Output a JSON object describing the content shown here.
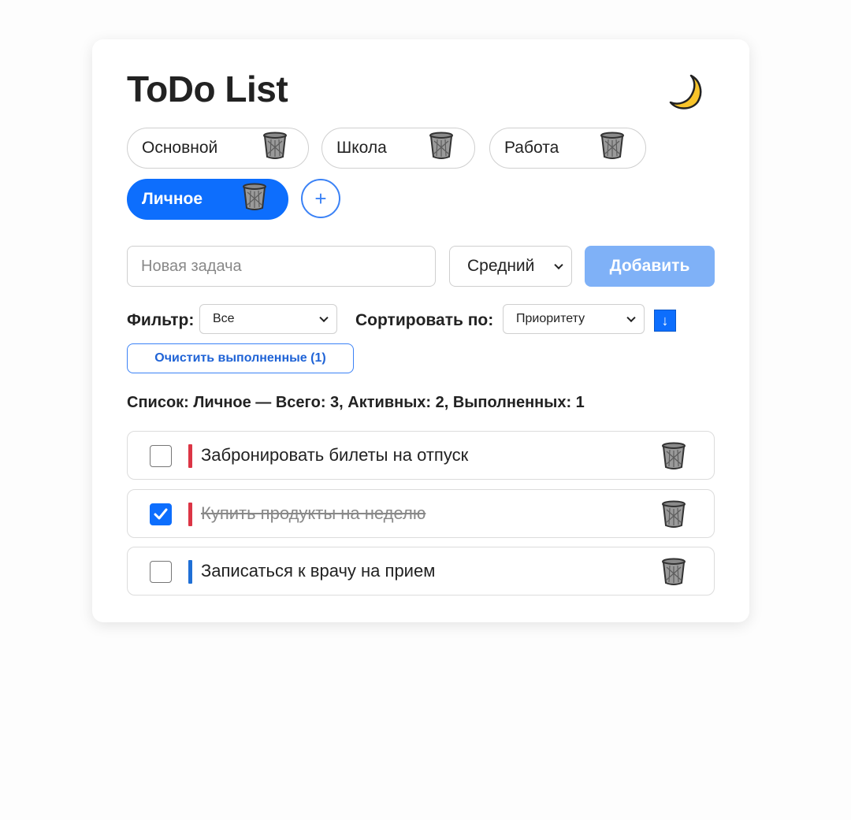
{
  "app": {
    "title": "ToDo List",
    "theme_icon": "crescent-moon-icon"
  },
  "lists": [
    {
      "label": "Основной",
      "active": false
    },
    {
      "label": "Школа",
      "active": false
    },
    {
      "label": "Работа",
      "active": false
    },
    {
      "label": "Личное",
      "active": true
    }
  ],
  "add_list_label": "+",
  "new_task": {
    "placeholder": "Новая задача",
    "value": "",
    "priority_selected": "Средний",
    "add_button_label": "Добавить"
  },
  "controls": {
    "filter_label": "Фильтр:",
    "filter_selected": "Все",
    "sort_label": "Сортировать по:",
    "sort_selected": "Приоритету",
    "sort_direction_icon": "↓",
    "clear_completed_label": "Очистить выполненные (1)"
  },
  "summary": "Список: Личное — Всего: 3, Активных: 2, Выполненных: 1",
  "tasks": [
    {
      "text": "Забронировать билеты на отпуск",
      "done": false,
      "priority_color": "#dc3545"
    },
    {
      "text": "Купить продукты на неделю",
      "done": true,
      "priority_color": "#dc3545"
    },
    {
      "text": "Записаться к врачу на прием",
      "done": false,
      "priority_color": "#1f6fd6"
    }
  ],
  "colors": {
    "accent": "#0d6efd",
    "add_button": "#7fb1f7",
    "priority_high": "#dc3545",
    "priority_low": "#1f6fd6"
  }
}
